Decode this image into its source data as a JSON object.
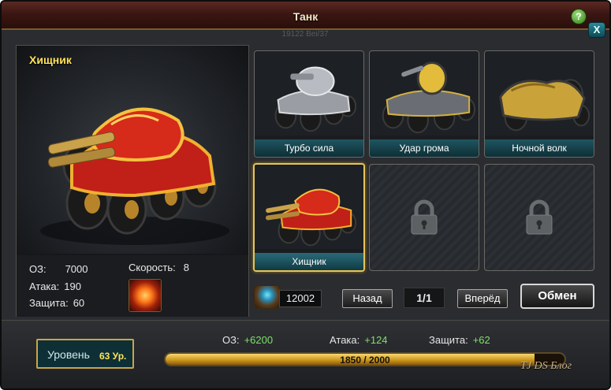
{
  "window": {
    "title": "Танк",
    "subtitle": "19122 Bei/37",
    "help_label": "?",
    "close_label": "X"
  },
  "preview": {
    "name": "Хищник"
  },
  "stats": {
    "hp_label": "ОЗ:",
    "hp_value": "7000",
    "attack_label": "Атака:",
    "attack_value": "190",
    "defense_label": "Защита:",
    "defense_value": "60",
    "speed_label": "Скорость:",
    "speed_value": "8"
  },
  "tanks": [
    {
      "label": "Турбо сила",
      "locked": false,
      "selected": false
    },
    {
      "label": "Удар грома",
      "locked": false,
      "selected": false
    },
    {
      "label": "Ночной волк",
      "locked": false,
      "selected": false
    },
    {
      "label": "Хищник",
      "locked": false,
      "selected": true
    },
    {
      "label": "",
      "locked": true,
      "selected": false
    },
    {
      "label": "",
      "locked": true,
      "selected": false
    }
  ],
  "controls": {
    "currency_value": "12002",
    "back_label": "Назад",
    "page_label": "1/1",
    "forward_label": "Вперёд",
    "exchange_label": "Обмен"
  },
  "footer": {
    "level_label": "Уровень",
    "level_value": "63 Ур.",
    "hp_bonus_label": "ОЗ:",
    "hp_bonus_value": "+6200",
    "attack_bonus_label": "Атака:",
    "attack_bonus_value": "+124",
    "defense_bonus_label": "Защита:",
    "defense_bonus_value": "+62",
    "xp_text": "1850 / 2000",
    "xp_fraction": 0.925
  },
  "watermark": "TJ DS Блог",
  "colors": {
    "accent_gold": "#e6c45a",
    "label_teal": "#1f5560",
    "bonus_green": "#7fe06a"
  }
}
